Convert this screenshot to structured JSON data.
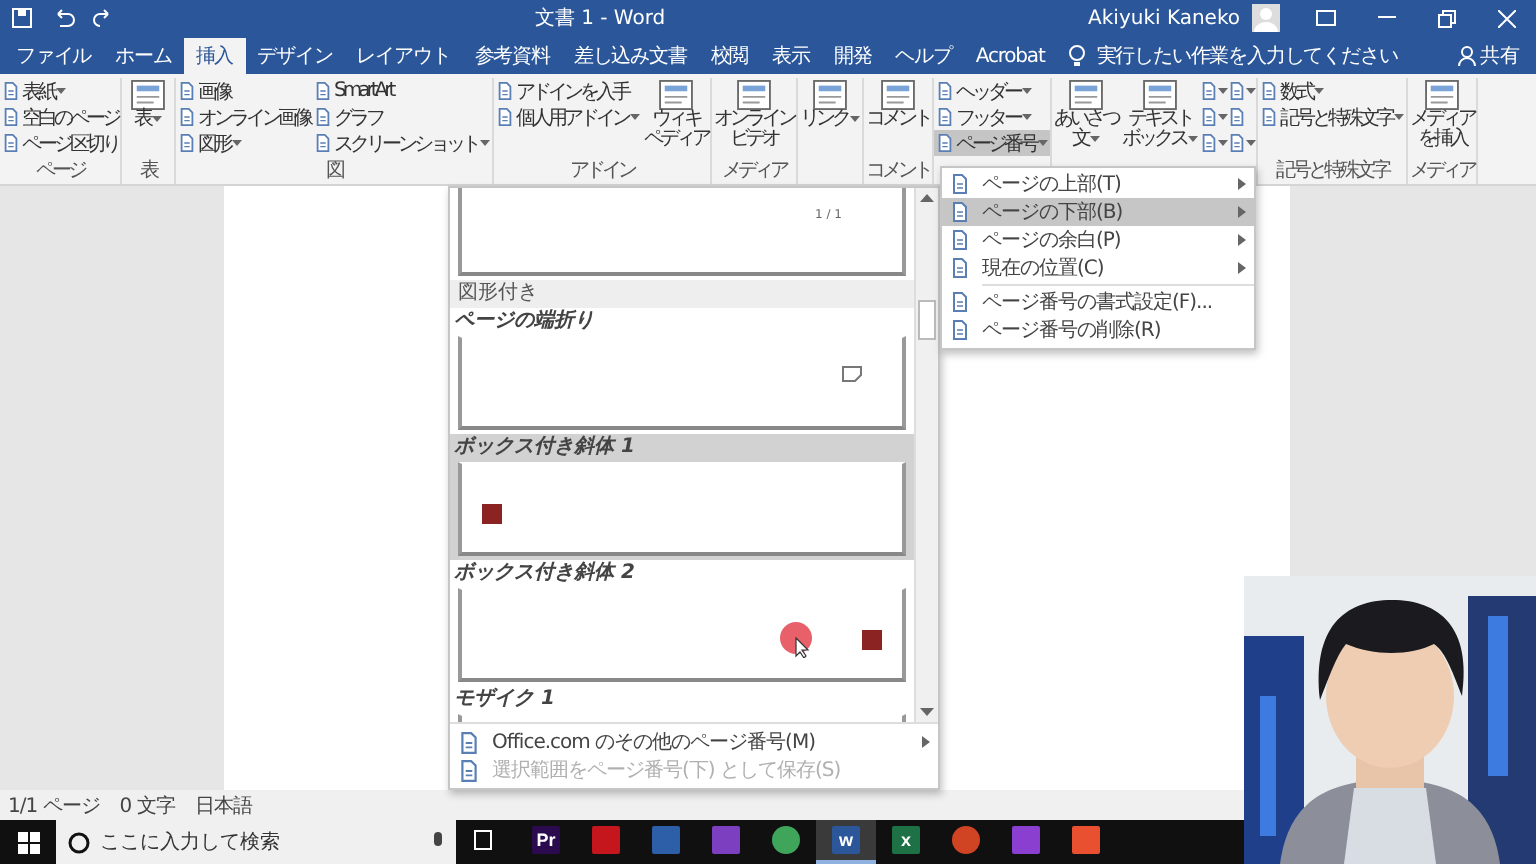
{
  "title_bar": {
    "title": "文書 1 - Word",
    "user": "Akiyuki Kaneko"
  },
  "tabs": [
    {
      "label": "ファイル",
      "selected": false
    },
    {
      "label": "ホーム",
      "selected": false
    },
    {
      "label": "挿入",
      "selected": true
    },
    {
      "label": "デザイン",
      "selected": false
    },
    {
      "label": "レイアウト",
      "selected": false
    },
    {
      "label": "参考資料",
      "selected": false
    },
    {
      "label": "差し込み文書",
      "selected": false
    },
    {
      "label": "校閲",
      "selected": false
    },
    {
      "label": "表示",
      "selected": false
    },
    {
      "label": "開発",
      "selected": false
    },
    {
      "label": "ヘルプ",
      "selected": false
    },
    {
      "label": "Acrobat",
      "selected": false
    }
  ],
  "tell_me": "実行したい作業を入力してください",
  "share": "共有",
  "ribbon_groups": [
    {
      "label": "ページ",
      "columns": [
        [
          {
            "kind": "small",
            "lines": [
              "表紙"
            ],
            "dropdown": true,
            "selected": false
          },
          {
            "kind": "small",
            "lines": [
              "空白のページ"
            ],
            "dropdown": false,
            "selected": false
          },
          {
            "kind": "small",
            "lines": [
              "ページ区切り"
            ],
            "dropdown": false,
            "selected": false
          }
        ]
      ]
    },
    {
      "label": "表",
      "columns": [
        [
          {
            "kind": "large",
            "lines": [
              "表"
            ],
            "dropdown": true,
            "selected": false
          }
        ]
      ]
    },
    {
      "label": "図",
      "columns": [
        [
          {
            "kind": "small",
            "lines": [
              "画像"
            ],
            "dropdown": false,
            "selected": false
          },
          {
            "kind": "small",
            "lines": [
              "オンライン画像"
            ],
            "dropdown": false,
            "selected": false
          },
          {
            "kind": "small",
            "lines": [
              "図形"
            ],
            "dropdown": true,
            "selected": false
          }
        ],
        [
          {
            "kind": "small",
            "lines": [
              "SmartArt"
            ],
            "dropdown": false,
            "selected": false
          },
          {
            "kind": "small",
            "lines": [
              "グラフ"
            ],
            "dropdown": false,
            "selected": false
          },
          {
            "kind": "small",
            "lines": [
              "スクリーンショット"
            ],
            "dropdown": true,
            "selected": false
          }
        ]
      ]
    },
    {
      "label": "アドイン",
      "columns": [
        [
          {
            "kind": "small",
            "lines": [
              "アドインを入手"
            ],
            "dropdown": false,
            "selected": false
          },
          {
            "kind": "small",
            "lines": [
              "個人用アドイン"
            ],
            "dropdown": true,
            "selected": false
          }
        ],
        [
          {
            "kind": "large",
            "lines": [
              "ウィキ",
              "ペディア"
            ],
            "dropdown": false,
            "selected": false
          }
        ]
      ]
    },
    {
      "label": "メディア",
      "columns": [
        [
          {
            "kind": "large",
            "lines": [
              "オンライン",
              "ビデオ"
            ],
            "dropdown": false,
            "selected": false
          }
        ]
      ]
    },
    {
      "columns": [
        [
          {
            "kind": "large",
            "lines": [
              "リンク"
            ],
            "dropdown": true,
            "selected": false
          }
        ]
      ]
    },
    {
      "label": "コメント",
      "columns": [
        [
          {
            "kind": "large",
            "lines": [
              "コメント"
            ],
            "dropdown": false,
            "selected": false
          }
        ]
      ]
    },
    {
      "columns": [
        [
          {
            "kind": "small",
            "lines": [
              "ヘッダー"
            ],
            "dropdown": true,
            "selected": false
          },
          {
            "kind": "small",
            "lines": [
              "フッター"
            ],
            "dropdown": true,
            "selected": false
          },
          {
            "kind": "small",
            "lines": [
              "ページ番号"
            ],
            "dropdown": true,
            "selected": true
          }
        ]
      ]
    },
    {
      "columns": [
        [
          {
            "kind": "large",
            "lines": [
              "あいさつ",
              "文"
            ],
            "dropdown": true,
            "selected": false
          }
        ],
        [
          {
            "kind": "large",
            "lines": [
              "テキスト",
              "ボックス"
            ],
            "dropdown": true,
            "selected": false
          }
        ],
        [
          {
            "kind": "icon",
            "dropdown": true,
            "selected": false
          },
          {
            "kind": "icon",
            "dropdown": true,
            "selected": false
          },
          {
            "kind": "icon",
            "dropdown": true,
            "selected": false
          }
        ],
        [
          {
            "kind": "icon",
            "dropdown": true,
            "selected": false
          },
          {
            "kind": "icon",
            "dropdown": false,
            "selected": false
          },
          {
            "kind": "icon",
            "dropdown": true,
            "selected": false
          }
        ]
      ]
    },
    {
      "label": "記号と特殊文字",
      "columns": [
        [
          {
            "kind": "small",
            "lines": [
              "数式"
            ],
            "dropdown": true,
            "selected": false
          },
          {
            "kind": "small",
            "lines": [
              "記号と特殊文字"
            ],
            "dropdown": true,
            "selected": false
          }
        ]
      ]
    },
    {
      "label": "メディア",
      "columns": [
        [
          {
            "kind": "large",
            "lines": [
              "メディア",
              "を挿入"
            ],
            "dropdown": false,
            "selected": false
          }
        ]
      ]
    }
  ],
  "gallery": {
    "entries": [
      {
        "kind": "item",
        "preview": {
          "kind": "number-text",
          "number": "1 / 1"
        },
        "selected": false,
        "cut_top": true,
        "cut_bottom": false
      },
      {
        "kind": "category",
        "label": "図形付き"
      },
      {
        "kind": "item",
        "label": "ページの端折り",
        "preview": {
          "kind": "fold"
        },
        "selected": false,
        "cut_top": false,
        "cut_bottom": false
      },
      {
        "kind": "item",
        "label": "ボックス付き斜体 1",
        "preview": {
          "kind": "box-left"
        },
        "selected": true,
        "cut_top": false,
        "cut_bottom": false
      },
      {
        "kind": "item",
        "label": "ボックス付き斜体 2",
        "preview": {
          "kind": "box-right"
        },
        "selected": false,
        "cut_top": false,
        "cut_bottom": false
      },
      {
        "kind": "item",
        "label": "モザイク 1",
        "preview": {
          "kind": "plain"
        },
        "selected": false,
        "cut_top": false,
        "cut_bottom": true
      }
    ],
    "footer": [
      {
        "label": "Office.com のその他のページ番号(M)",
        "disabled": false,
        "submenu": true
      },
      {
        "label": "選択範囲をページ番号(下) として保存(S)",
        "disabled": true,
        "submenu": false
      }
    ]
  },
  "submenu": [
    {
      "kind": "position",
      "label": "ページの上部(T)",
      "selected": false
    },
    {
      "kind": "position",
      "label": "ページの下部(B)",
      "selected": true
    },
    {
      "kind": "position",
      "label": "ページの余白(P)",
      "selected": false
    },
    {
      "kind": "position",
      "label": "現在の位置(C)",
      "selected": false
    },
    {
      "kind": "action",
      "label": "ページ番号の書式設定(F)...",
      "selected": false
    },
    {
      "kind": "action",
      "label": "ページ番号の削除(R)",
      "selected": false
    }
  ],
  "status_bar": [
    "1/1 ページ",
    "0 文字",
    "日本語"
  ],
  "taskbar": {
    "search_placeholder": "ここに入力して検索",
    "apps": [
      {
        "glyph": "Pr",
        "color": "#2b0a4d",
        "active": false
      },
      {
        "color": "#c4161c",
        "active": false
      },
      {
        "color": "#2d5fa8",
        "active": false
      },
      {
        "color": "#7b3fbf",
        "active": false
      },
      {
        "color": "#3fa55a",
        "active": false
      },
      {
        "glyph": "w",
        "color": "#2b579a",
        "active": true
      },
      {
        "glyph": "x",
        "color": "#1e7145",
        "active": false
      },
      {
        "color": "#d04423",
        "active": false
      },
      {
        "color": "#8a3fd1",
        "active": false
      },
      {
        "color": "#e8502f",
        "active": false
      }
    ]
  }
}
